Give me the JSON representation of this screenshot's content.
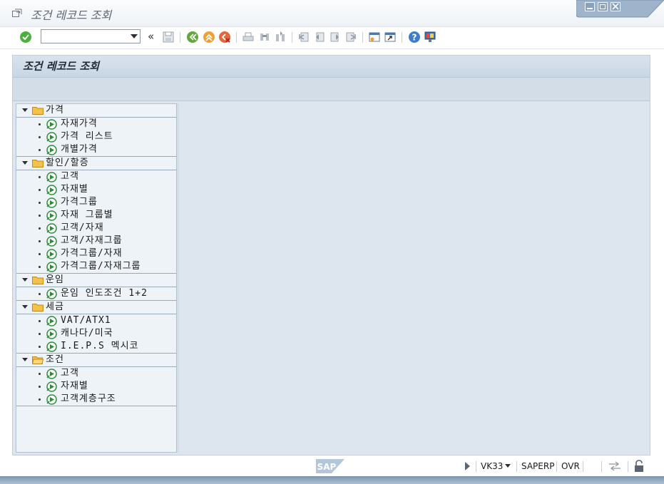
{
  "window": {
    "title": "조건 레코드 조회"
  },
  "toolbar": {
    "command_value": "",
    "icons": [
      "enter-icon",
      "save-icon",
      "back-icon",
      "exit-icon",
      "cancel-icon",
      "print-icon",
      "find-icon",
      "find-next-icon",
      "first-page-icon",
      "previous-page-icon",
      "next-page-icon",
      "last-page-icon",
      "create-session-icon",
      "shortcut-icon",
      "help-icon",
      "customize-layout-icon"
    ]
  },
  "screen": {
    "title": "조건 레코드 조회"
  },
  "tree": [
    {
      "label": "가격",
      "items": [
        "자재가격",
        "가격 리스트",
        "개별가격"
      ]
    },
    {
      "label": "할인/할증",
      "items": [
        "고객",
        "자재별",
        "가격그룹",
        "자재 그룹별",
        "고객/자재",
        "고객/자재그룹",
        "가격그룹/자재",
        "가격그룹/자재그룹"
      ]
    },
    {
      "label": "운임",
      "items": [
        "운임 인도조건 1+2"
      ]
    },
    {
      "label": "세금",
      "items": [
        "VAT/ATX1",
        "캐나다/미국",
        "I.E.P.S 멕시코"
      ]
    },
    {
      "label": "조건",
      "items": [
        "고객",
        "자재별",
        "고객계층구조"
      ]
    }
  ],
  "status": {
    "logo_text": "SAP",
    "transaction": "VK33",
    "system": "SAPERP",
    "mode": "OVR"
  },
  "colors": {
    "folder": "#f4c14b",
    "exec_icon": "#2e8b3a",
    "enter_icon": "#4caf3c"
  }
}
